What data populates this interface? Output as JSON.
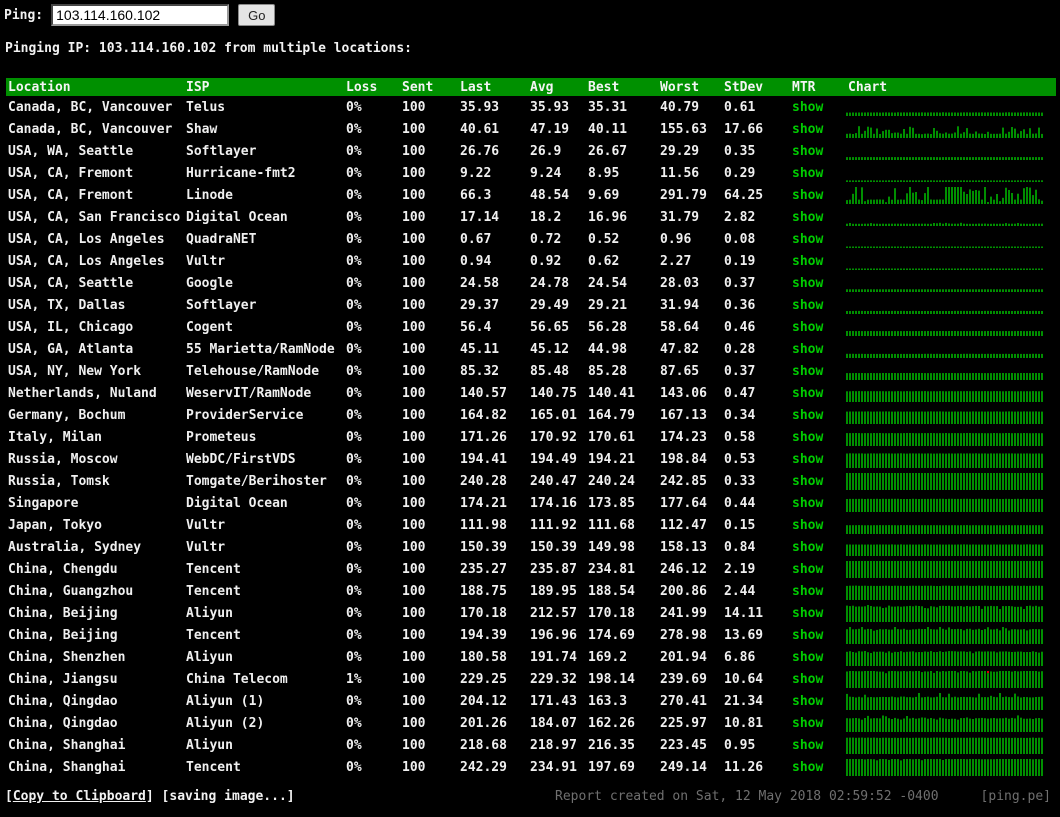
{
  "ping_bar": {
    "label": "Ping:",
    "input_value": "103.114.160.102",
    "go_label": "Go"
  },
  "subtitle": "Pinging IP: 103.114.160.102 from multiple locations:",
  "table": {
    "headers": [
      "Location",
      "ISP",
      "Loss",
      "Sent",
      "Last",
      "Avg",
      "Best",
      "Worst",
      "StDev",
      "MTR",
      "Chart"
    ],
    "mtr_link_label": "show",
    "rows": [
      {
        "location": "Canada, BC, Vancouver",
        "isp": "Telus",
        "loss": "0%",
        "sent": "100",
        "last": "35.93",
        "avg": "35.93",
        "best": "35.31",
        "worst": "40.79",
        "stdev": "0.61"
      },
      {
        "location": "Canada, BC, Vancouver",
        "isp": "Shaw",
        "loss": "0%",
        "sent": "100",
        "last": "40.61",
        "avg": "47.19",
        "best": "40.11",
        "worst": "155.63",
        "stdev": "17.66"
      },
      {
        "location": "USA, WA, Seattle",
        "isp": "Softlayer",
        "loss": "0%",
        "sent": "100",
        "last": "26.76",
        "avg": "26.9",
        "best": "26.67",
        "worst": "29.29",
        "stdev": "0.35"
      },
      {
        "location": "USA, CA, Fremont",
        "isp": "Hurricane-fmt2",
        "loss": "0%",
        "sent": "100",
        "last": "9.22",
        "avg": "9.24",
        "best": "8.95",
        "worst": "11.56",
        "stdev": "0.29"
      },
      {
        "location": "USA, CA, Fremont",
        "isp": "Linode",
        "loss": "0%",
        "sent": "100",
        "last": "66.3",
        "avg": "48.54",
        "best": "9.69",
        "worst": "291.79",
        "stdev": "64.25"
      },
      {
        "location": "USA, CA, San Francisco",
        "isp": "Digital Ocean",
        "loss": "0%",
        "sent": "100",
        "last": "17.14",
        "avg": "18.2",
        "best": "16.96",
        "worst": "31.79",
        "stdev": "2.82"
      },
      {
        "location": "USA, CA, Los Angeles",
        "isp": "QuadraNET",
        "loss": "0%",
        "sent": "100",
        "last": "0.67",
        "avg": "0.72",
        "best": "0.52",
        "worst": "0.96",
        "stdev": "0.08"
      },
      {
        "location": "USA, CA, Los Angeles",
        "isp": "Vultr",
        "loss": "0%",
        "sent": "100",
        "last": "0.94",
        "avg": "0.92",
        "best": "0.62",
        "worst": "2.27",
        "stdev": "0.19"
      },
      {
        "location": "USA, CA, Seattle",
        "isp": "Google",
        "loss": "0%",
        "sent": "100",
        "last": "24.58",
        "avg": "24.78",
        "best": "24.54",
        "worst": "28.03",
        "stdev": "0.37"
      },
      {
        "location": "USA, TX, Dallas",
        "isp": "Softlayer",
        "loss": "0%",
        "sent": "100",
        "last": "29.37",
        "avg": "29.49",
        "best": "29.21",
        "worst": "31.94",
        "stdev": "0.36"
      },
      {
        "location": "USA, IL, Chicago",
        "isp": "Cogent",
        "loss": "0%",
        "sent": "100",
        "last": "56.4",
        "avg": "56.65",
        "best": "56.28",
        "worst": "58.64",
        "stdev": "0.46"
      },
      {
        "location": "USA, GA, Atlanta",
        "isp": "55 Marietta/RamNode",
        "loss": "0%",
        "sent": "100",
        "last": "45.11",
        "avg": "45.12",
        "best": "44.98",
        "worst": "47.82",
        "stdev": "0.28"
      },
      {
        "location": "USA, NY, New York",
        "isp": "Telehouse/RamNode",
        "loss": "0%",
        "sent": "100",
        "last": "85.32",
        "avg": "85.48",
        "best": "85.28",
        "worst": "87.65",
        "stdev": "0.37"
      },
      {
        "location": "Netherlands, Nuland",
        "isp": "WeservIT/RamNode",
        "loss": "0%",
        "sent": "100",
        "last": "140.57",
        "avg": "140.75",
        "best": "140.41",
        "worst": "143.06",
        "stdev": "0.47"
      },
      {
        "location": "Germany, Bochum",
        "isp": "ProviderService",
        "loss": "0%",
        "sent": "100",
        "last": "164.82",
        "avg": "165.01",
        "best": "164.79",
        "worst": "167.13",
        "stdev": "0.34"
      },
      {
        "location": "Italy, Milan",
        "isp": "Prometeus",
        "loss": "0%",
        "sent": "100",
        "last": "171.26",
        "avg": "170.92",
        "best": "170.61",
        "worst": "174.23",
        "stdev": "0.58"
      },
      {
        "location": "Russia, Moscow",
        "isp": "WebDC/FirstVDS",
        "loss": "0%",
        "sent": "100",
        "last": "194.41",
        "avg": "194.49",
        "best": "194.21",
        "worst": "198.84",
        "stdev": "0.53"
      },
      {
        "location": "Russia, Tomsk",
        "isp": "Tomgate/Berihoster",
        "loss": "0%",
        "sent": "100",
        "last": "240.28",
        "avg": "240.47",
        "best": "240.24",
        "worst": "242.85",
        "stdev": "0.33"
      },
      {
        "location": "Singapore",
        "isp": "Digital Ocean",
        "loss": "0%",
        "sent": "100",
        "last": "174.21",
        "avg": "174.16",
        "best": "173.85",
        "worst": "177.64",
        "stdev": "0.44"
      },
      {
        "location": "Japan, Tokyo",
        "isp": "Vultr",
        "loss": "0%",
        "sent": "100",
        "last": "111.98",
        "avg": "111.92",
        "best": "111.68",
        "worst": "112.47",
        "stdev": "0.15"
      },
      {
        "location": "Australia, Sydney",
        "isp": "Vultr",
        "loss": "0%",
        "sent": "100",
        "last": "150.39",
        "avg": "150.39",
        "best": "149.98",
        "worst": "158.13",
        "stdev": "0.84"
      },
      {
        "location": "China, Chengdu",
        "isp": "Tencent",
        "loss": "0%",
        "sent": "100",
        "last": "235.27",
        "avg": "235.87",
        "best": "234.81",
        "worst": "246.12",
        "stdev": "2.19"
      },
      {
        "location": "China, Guangzhou",
        "isp": "Tencent",
        "loss": "0%",
        "sent": "100",
        "last": "188.75",
        "avg": "189.95",
        "best": "188.54",
        "worst": "200.86",
        "stdev": "2.44"
      },
      {
        "location": "China, Beijing",
        "isp": "Aliyun",
        "loss": "0%",
        "sent": "100",
        "last": "170.18",
        "avg": "212.57",
        "best": "170.18",
        "worst": "241.99",
        "stdev": "14.11"
      },
      {
        "location": "China, Beijing",
        "isp": "Tencent",
        "loss": "0%",
        "sent": "100",
        "last": "194.39",
        "avg": "196.96",
        "best": "174.69",
        "worst": "278.98",
        "stdev": "13.69"
      },
      {
        "location": "China, Shenzhen",
        "isp": "Aliyun",
        "loss": "0%",
        "sent": "100",
        "last": "180.58",
        "avg": "191.74",
        "best": "169.2",
        "worst": "201.94",
        "stdev": "6.86"
      },
      {
        "location": "China, Jiangsu",
        "isp": "China Telecom",
        "loss": "1%",
        "sent": "100",
        "last": "229.25",
        "avg": "229.32",
        "best": "198.14",
        "worst": "239.69",
        "stdev": "10.64",
        "loss_marker": 0.73
      },
      {
        "location": "China, Qingdao",
        "isp": "Aliyun (1)",
        "loss": "0%",
        "sent": "100",
        "last": "204.12",
        "avg": "171.43",
        "best": "163.3",
        "worst": "270.41",
        "stdev": "21.34"
      },
      {
        "location": "China, Qingdao",
        "isp": "Aliyun (2)",
        "loss": "0%",
        "sent": "100",
        "last": "201.26",
        "avg": "184.07",
        "best": "162.26",
        "worst": "225.97",
        "stdev": "10.81"
      },
      {
        "location": "China, Shanghai",
        "isp": "Aliyun",
        "loss": "0%",
        "sent": "100",
        "last": "218.68",
        "avg": "218.97",
        "best": "216.35",
        "worst": "223.45",
        "stdev": "0.95"
      },
      {
        "location": "China, Shanghai",
        "isp": "Tencent",
        "loss": "0%",
        "sent": "100",
        "last": "242.29",
        "avg": "234.91",
        "best": "197.69",
        "worst": "249.14",
        "stdev": "11.26"
      }
    ]
  },
  "chart_style": {
    "bar_color": "#008f00",
    "loss_color": "#dd0000",
    "header_bg": "#009000",
    "link_color": "#00cc00"
  },
  "footer": {
    "copy_open": "[",
    "copy_label": "Copy to Clipboard",
    "copy_close": "]",
    "saving_label": "[saving image...]",
    "report_text": "Report created on Sat, 12 May 2018 02:59:52 -0400",
    "brand": "[ping.pe]"
  }
}
